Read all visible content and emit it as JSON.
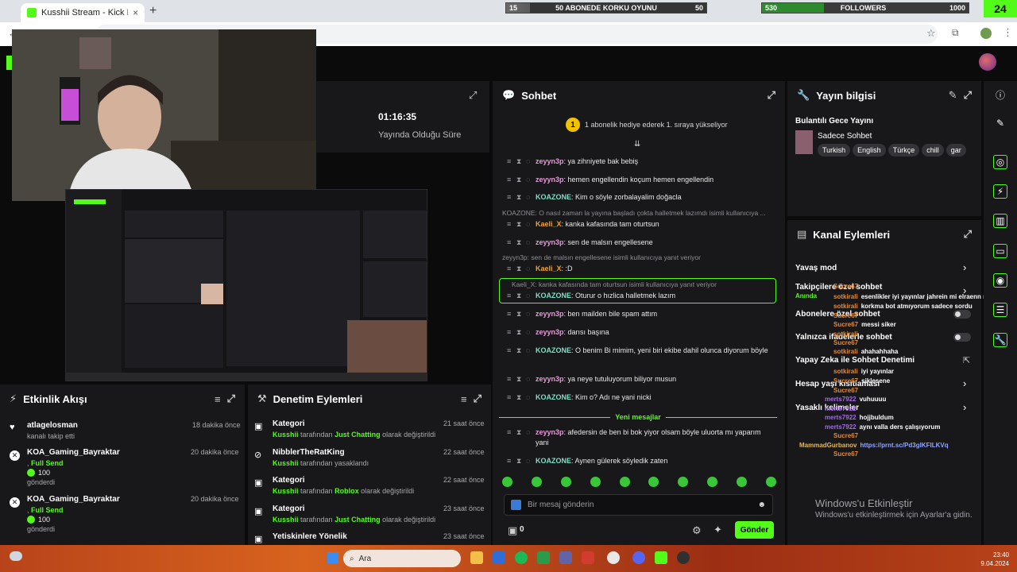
{
  "browser": {
    "tab_title": "Kusshii Stream - Kick Dashboar",
    "tab_close": "×",
    "new_tab": "+"
  },
  "overlay": {
    "goal_min": "15",
    "goal_label": "50 ABONEDE KORKU OYUNU",
    "goal_max": "50",
    "followers_min": "530",
    "followers_label": "FOLLOWERS",
    "followers_max": "1000",
    "followers_progress": 0.3,
    "kick_badge": "24"
  },
  "stats": {
    "duration_value": "01:16:35",
    "duration_label": "Yayında Olduğu Süre"
  },
  "chat": {
    "title": "Sohbet",
    "gift_banner": "1 abonelik hediye ederek 1. sıraya yükseliyor",
    "gift_badge": "1",
    "messages": [
      {
        "user": "zeyyn3p",
        "text": "ya zihniyete bak bebiş",
        "color": "#e59ad8"
      },
      {
        "user": "zeyyn3p",
        "text": "hemen engellendin koçum hemen engellendin",
        "color": "#e59ad8"
      },
      {
        "user": "KOAZONE",
        "text": "Kim o söyle zorbalayalim doğacla",
        "color": "#7be0c8"
      },
      {
        "user": "Kaeli_X",
        "text": "kanka kafasında tam oturtsun",
        "color": "#f0a030"
      },
      {
        "user": "zeyyn3p",
        "text": "sen de malsın engellesene",
        "color": "#e59ad8"
      },
      {
        "user": "Kaeli_X",
        "text": ":D",
        "color": "#f0a030"
      },
      {
        "user": "KOAZONE",
        "text": "Oturur o hızlica halletmek lazım",
        "color": "#7be0c8"
      },
      {
        "user": "zeyyn3p",
        "text": "ben mailden bile spam attım",
        "color": "#e59ad8"
      },
      {
        "user": "zeyyn3p",
        "text": "darısı başına",
        "color": "#e59ad8"
      },
      {
        "user": "KOAZONE",
        "text": "O benim Bi mimim, yeni biri ekibe dahil olunca diyorum böyle",
        "color": "#7be0c8"
      },
      {
        "user": "zeyyn3p",
        "text": "ya neye tutuluyorum biliyor musun",
        "color": "#e59ad8"
      },
      {
        "user": "KOAZONE",
        "text": "Kim o? Adı ne yani nicki",
        "color": "#7be0c8"
      },
      {
        "user": "zeyyn3p",
        "text": "afedersin de ben bi bok yiyor olsam böyle uluorta mı yaparım yani",
        "color": "#e59ad8"
      },
      {
        "user": "KOAZONE",
        "text": "Aynen gülerek söyledik zaten",
        "color": "#7be0c8"
      }
    ],
    "replies": [
      "KOAZONE: O nasıl zaman la yayına başladı çokta halletmek lazımdı isimli kullanıcıya ...",
      "zeyyn3p: sen de malsın engellesene isimli kullanıcıya yanıt veriyor",
      "Kaeli_X: kanka kafasında tam oturtsun isimli kullanıcıya yanıt veriyor"
    ],
    "new_messages": "Yeni mesajlar",
    "input_placeholder": "Bir mesaj gönderin",
    "points": "0",
    "send_label": "Gönder"
  },
  "stream_info": {
    "title": "Yayın bilgisi",
    "stream_title": "Bulantılı Gece Yayını",
    "category": "Sadece Sohbet",
    "tags": [
      "Turkish",
      "English",
      "Türkçe",
      "chill",
      "gar"
    ]
  },
  "channel_actions": {
    "title": "Kanal Eylemleri",
    "rows": [
      "Yavaş mod",
      "Takipçilere özel sohbet",
      "Anında",
      "Abonelere özel sohbet",
      "Yalnızca ifadelerle sohbet",
      "Yapay Zeka ile Sohbet Denetimi",
      "Hesap yaşı kısıtlaması",
      "Yasaklı kelimeler"
    ]
  },
  "overlay_chat": [
    {
      "user": "Sucre67",
      "text": "",
      "color": "#e08a3a"
    },
    {
      "user": "sotkirali",
      "text": "esenlikler iyi yayınlar jahrein mi elraenn mi ?",
      "color": "#e08a3a"
    },
    {
      "user": "sotkirali",
      "text": "korkma bot atmıyorum sadece sordu",
      "color": "#e08a3a"
    },
    {
      "user": "Sucre67",
      "text": "",
      "color": "#e08a3a"
    },
    {
      "user": "Sucre67",
      "text": "messi siker",
      "color": "#e08a3a"
    },
    {
      "user": "sotkirali",
      "text": "",
      "color": "#e08a3a"
    },
    {
      "user": "Sucre67",
      "text": "",
      "color": "#e08a3a"
    },
    {
      "user": "sotkirali",
      "text": "ahahahhaha",
      "color": "#e08a3a"
    },
    {
      "user": "sotkirali",
      "text": "iyi yayınlar",
      "color": "#e08a3a"
    },
    {
      "user": "Sucre67",
      "text": "siklesene",
      "color": "#e08a3a"
    },
    {
      "user": "Sucre67",
      "text": "",
      "color": "#e08a3a"
    },
    {
      "user": "merts7922",
      "text": "vuhuuuu",
      "color": "#a36ae8"
    },
    {
      "user": "merts7922",
      "text": "",
      "color": "#a36ae8"
    },
    {
      "user": "merts7922",
      "text": "hojjbuldum",
      "color": "#a36ae8"
    },
    {
      "user": "merts7922",
      "text": "aynı valla ders çalışıyorum",
      "color": "#a36ae8"
    },
    {
      "user": "Sucre67",
      "text": "",
      "color": "#e08a3a"
    },
    {
      "user": "MammadGurbanov",
      "text": "https://prnt.sc/Pd3gIKFILKVq",
      "color": "#e8b84a"
    },
    {
      "user": "Sucre67",
      "text": "",
      "color": "#e08a3a"
    }
  ],
  "activity": {
    "title": "Etkinlik Akışı",
    "events": [
      {
        "name": "atlagelosman",
        "detail": "kanalı takip etti",
        "time": "18 dakika önce"
      },
      {
        "name": "KOA_Gaming_Bayraktar",
        "tier": "Full Send",
        "amount": "100",
        "detail": "gönderdi",
        "time": "20 dakika önce"
      },
      {
        "name": "KOA_Gaming_Bayraktar",
        "tier": "Full Send",
        "amount": "100",
        "detail": "gönderdi",
        "time": "20 dakika önce"
      }
    ]
  },
  "moderation": {
    "title": "Denetim Eylemleri",
    "events": [
      {
        "title": "Kategori",
        "by": "Kusshii",
        "mid": "tarafından",
        "target": "Just Chatting",
        "end": "olarak değiştirildi",
        "time": "21 saat önce"
      },
      {
        "title": "NibblerTheRatKing",
        "by": "Kusshii",
        "mid": "tarafından yasaklandı",
        "target": "",
        "end": "",
        "time": "22 saat önce"
      },
      {
        "title": "Kategori",
        "by": "Kusshii",
        "mid": "tarafından",
        "target": "Roblox",
        "end": "olarak değiştirildi",
        "time": "22 saat önce"
      },
      {
        "title": "Kategori",
        "by": "Kusshii",
        "mid": "tarafından",
        "target": "Just Chatting",
        "end": "olarak değiştirildi",
        "time": "23 saat önce"
      },
      {
        "title": "Yetiskinlere Yönelik",
        "by": "",
        "mid": "",
        "target": "",
        "end": "",
        "time": "23 saat önce"
      }
    ]
  },
  "watermark": {
    "title": "Windows'u Etkinleştir",
    "subtitle": "Windows'u etkinleştirmek için Ayarlar'a gidin."
  },
  "taskbar": {
    "search_placeholder": "Ara",
    "time": "23:40",
    "date": "9.04.2024"
  },
  "colors": {
    "accent": "#53fc18",
    "panel": "#18181b",
    "background": "#0b0b0c"
  }
}
